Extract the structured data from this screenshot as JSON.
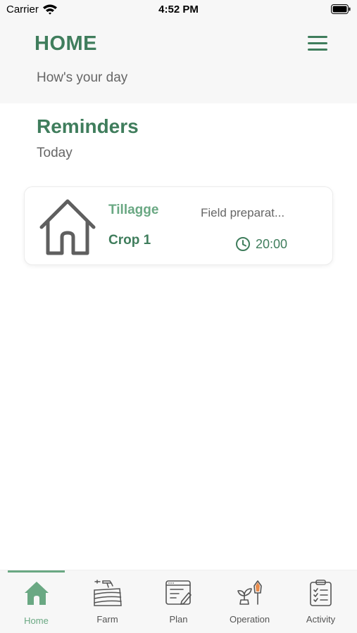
{
  "status_bar": {
    "carrier": "Carrier",
    "time": "4:52 PM"
  },
  "header": {
    "title": "HOME",
    "subtitle": "How's your day",
    "menu_icon": "hamburger-menu-icon"
  },
  "reminders": {
    "title": "Reminders",
    "period": "Today",
    "items": [
      {
        "activity": "Tillagge",
        "crop": "Crop 1",
        "description": "Field preparat...",
        "time": "20:00",
        "icon": "house-icon"
      }
    ]
  },
  "tab_bar": {
    "active": "Home",
    "tabs": [
      {
        "label": "Home",
        "icon": "home-icon"
      },
      {
        "label": "Farm",
        "icon": "farm-field-icon"
      },
      {
        "label": "Plan",
        "icon": "plan-board-icon"
      },
      {
        "label": "Operation",
        "icon": "seedling-trowel-icon"
      },
      {
        "label": "Activity",
        "icon": "clipboard-checklist-icon"
      }
    ]
  },
  "colors": {
    "primary": "#3f7d5c",
    "accent": "#6aa883",
    "header_bg": "#f7f7f7",
    "muted_text": "#666666"
  }
}
